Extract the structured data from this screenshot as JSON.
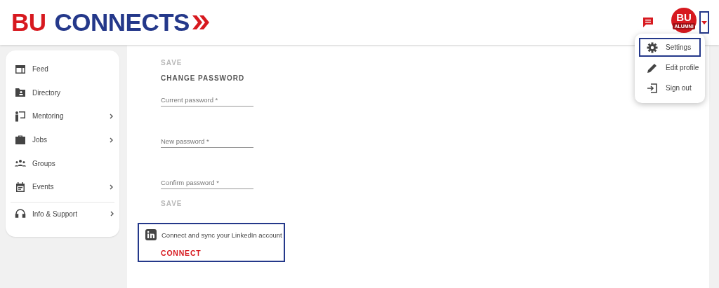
{
  "header": {
    "logo": {
      "first": "BU",
      "second": "CONNECTS"
    },
    "avatar": {
      "initials": "BU",
      "caption": "ALUMNI"
    }
  },
  "user_menu": {
    "expanded": true,
    "items": [
      {
        "label": "Settings",
        "selected": true
      },
      {
        "label": "Edit profile",
        "selected": false
      },
      {
        "label": "Sign out",
        "selected": false
      }
    ]
  },
  "sidebar": {
    "groups": [
      [
        {
          "label": "Feed",
          "has_submenu": false
        },
        {
          "label": "Directory",
          "has_submenu": false
        },
        {
          "label": "Mentoring",
          "has_submenu": true
        },
        {
          "label": "Jobs",
          "has_submenu": true
        },
        {
          "label": "Groups",
          "has_submenu": false
        },
        {
          "label": "Events",
          "has_submenu": true
        }
      ],
      [
        {
          "label": "Info & Support",
          "has_submenu": true
        }
      ]
    ]
  },
  "main": {
    "top_save": "SAVE",
    "section_title": "CHANGE PASSWORD",
    "fields": [
      {
        "placeholder": "Current password *"
      },
      {
        "placeholder": "New password *"
      },
      {
        "placeholder": "Confirm password *"
      }
    ],
    "save": "SAVE",
    "linkedin": {
      "text": "Connect and sync your LinkedIn account",
      "button": "CONNECT",
      "highlighted": true
    }
  }
}
